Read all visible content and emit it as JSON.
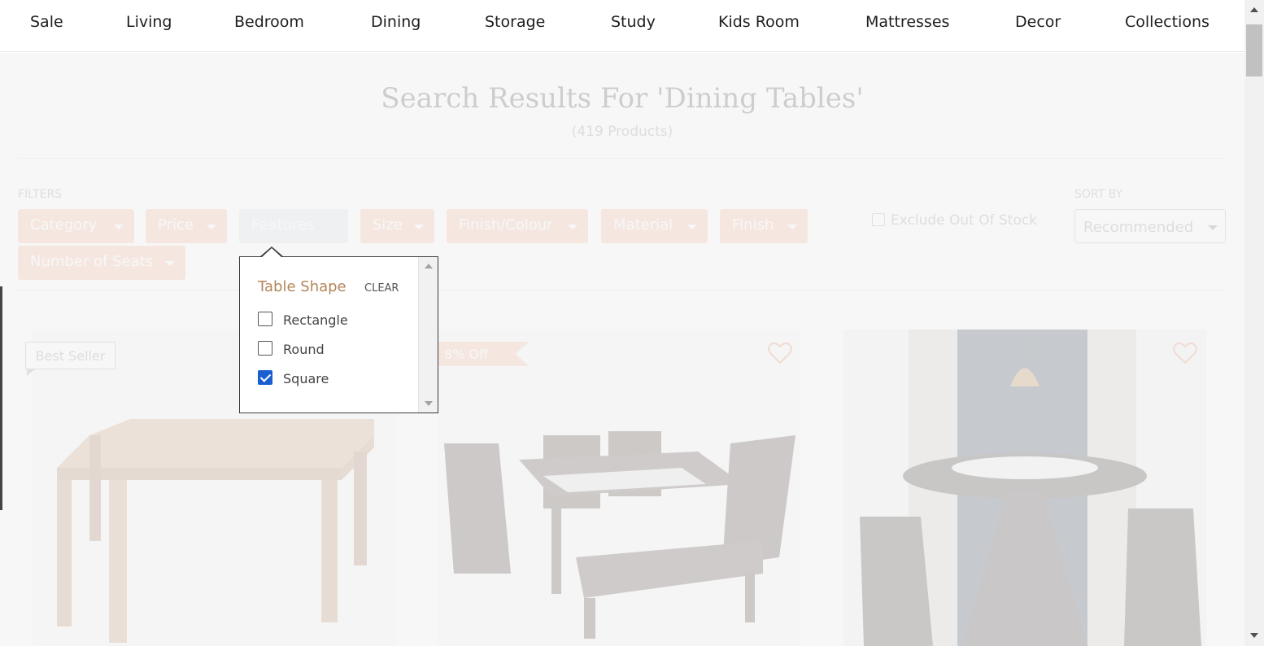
{
  "nav": {
    "items": [
      "Sale",
      "Living",
      "Bedroom",
      "Dining",
      "Storage",
      "Study",
      "Kids Room",
      "Mattresses",
      "Decor",
      "Collections"
    ]
  },
  "search": {
    "title": "Search Results For 'Dining Tables'",
    "count": "(419 Products)"
  },
  "filters": {
    "label": "FILTERS",
    "chips": [
      "Category",
      "Price",
      "Features",
      "Size",
      "Finish/Colour",
      "Material",
      "Finish",
      "Number of Seats"
    ],
    "active": "Features",
    "exclude_label": "Exclude Out Of Stock",
    "exclude_checked": false
  },
  "sort": {
    "label": "SORT BY",
    "value": "Recommended"
  },
  "dropdown": {
    "title": "Table Shape",
    "clear_label": "CLEAR",
    "options": [
      {
        "label": "Rectangle",
        "checked": false
      },
      {
        "label": "Round",
        "checked": false
      },
      {
        "label": "Square",
        "checked": true
      }
    ]
  },
  "products": {
    "badge_best": "Best Seller",
    "badge_off": "8% Off",
    "icons": [
      "heart-icon",
      "heart-icon"
    ]
  },
  "colors": {
    "chip": "#f6b597",
    "accent_brown": "#b3855a",
    "checkbox": "#1a5fd0"
  }
}
